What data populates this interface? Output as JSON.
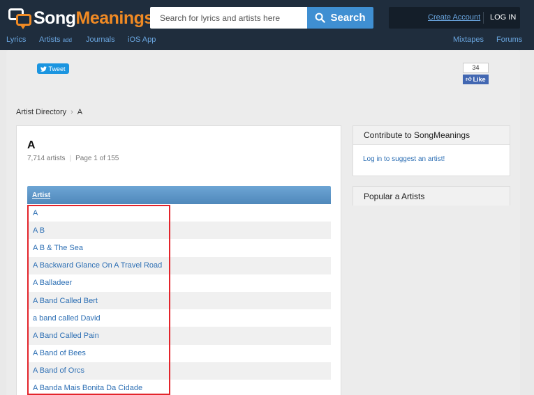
{
  "header": {
    "logo_word1": "Song",
    "logo_word2": "Meanings",
    "search_placeholder": "Search for lyrics and artists here",
    "search_button": "Search",
    "create_account": "Create Account",
    "login": "LOG IN"
  },
  "nav": {
    "lyrics": "Lyrics",
    "artists": "Artists",
    "artists_badge": "add",
    "journals": "Journals",
    "ios_app": "iOS App",
    "mixtapes": "Mixtapes",
    "forums": "Forums"
  },
  "social": {
    "tweet": "Tweet",
    "like_count": "34",
    "like": "Like"
  },
  "breadcrumb": {
    "root": "Artist Directory",
    "sep": "›",
    "current": "A"
  },
  "listing": {
    "title": "A",
    "artist_count": "7,714 artists",
    "page_info": "Page 1 of 155",
    "column_header": "Artist",
    "artists": [
      "A",
      "A B",
      "A B & The Sea",
      "A Backward Glance On A Travel Road",
      "A Balladeer",
      "A Band Called Bert",
      "a band called David",
      "A Band Called Pain",
      "A Band of Bees",
      "A Band of Orcs",
      "A Banda Mais Bonita Da Cidade"
    ]
  },
  "sidebar": {
    "contribute_title": "Contribute to SongMeanings",
    "contribute_link": "Log in to suggest an artist!",
    "popular_title": "Popular a Artists"
  },
  "colors": {
    "header_bg": "#1f2d3d",
    "accent_orange": "#f08a24",
    "link_blue": "#2d6fb4",
    "search_button": "#3f8fd2",
    "highlight_red": "#e3242b"
  }
}
